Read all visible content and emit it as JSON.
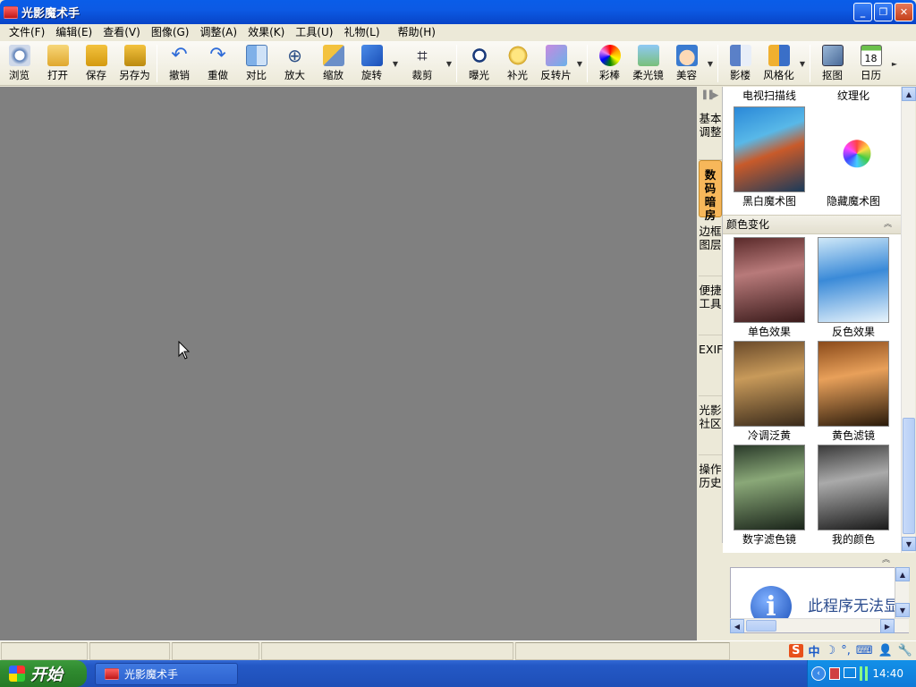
{
  "window": {
    "title": "光影魔术手"
  },
  "menu": [
    "文件(F)",
    "编辑(E)",
    "查看(V)",
    "图像(G)",
    "调整(A)",
    "效果(K)",
    "工具(U)",
    "礼物(L)",
    "帮助(H)"
  ],
  "toolbar": {
    "group1": [
      "浏览",
      "打开",
      "保存",
      "另存为"
    ],
    "group2": [
      "撤销",
      "重做",
      "对比",
      "放大",
      "缩放",
      "旋转"
    ],
    "group3": [
      "裁剪"
    ],
    "group4": [
      "曝光",
      "补光",
      "反转片"
    ],
    "group5": [
      "彩棒",
      "柔光镜",
      "美容"
    ],
    "group6": [
      "影楼",
      "风格化"
    ],
    "group7": [
      "抠图",
      "日历"
    ]
  },
  "side_tabs": [
    "基本调整",
    "数码暗房",
    "边框图层",
    "便捷工具",
    "EXIF",
    "光影社区",
    "操作历史"
  ],
  "active_tab_index": 1,
  "panel": {
    "top_row": [
      "电视扫描线",
      "纹理化"
    ],
    "row1": [
      "黑白魔术图",
      "隐藏魔术图"
    ],
    "section_title": "颜色变化",
    "color_effects": [
      "单色效果",
      "反色效果",
      "冷调泛黄",
      "黄色滤镜",
      "数字滤色镜",
      "我的颜色"
    ]
  },
  "info_text": "此程序无法显示网页",
  "status_cells": [
    "",
    "",
    "",
    "",
    ""
  ],
  "ime": [
    "中",
    "☽",
    "°,",
    "⌨",
    "👤",
    "🔧"
  ],
  "taskbar": {
    "start": "开始",
    "task": "光影魔术手",
    "time": "14:40"
  },
  "colors": {
    "canvas": "#808080",
    "active_tab": "#f7b75a",
    "title_blue": "#0a5de8"
  }
}
